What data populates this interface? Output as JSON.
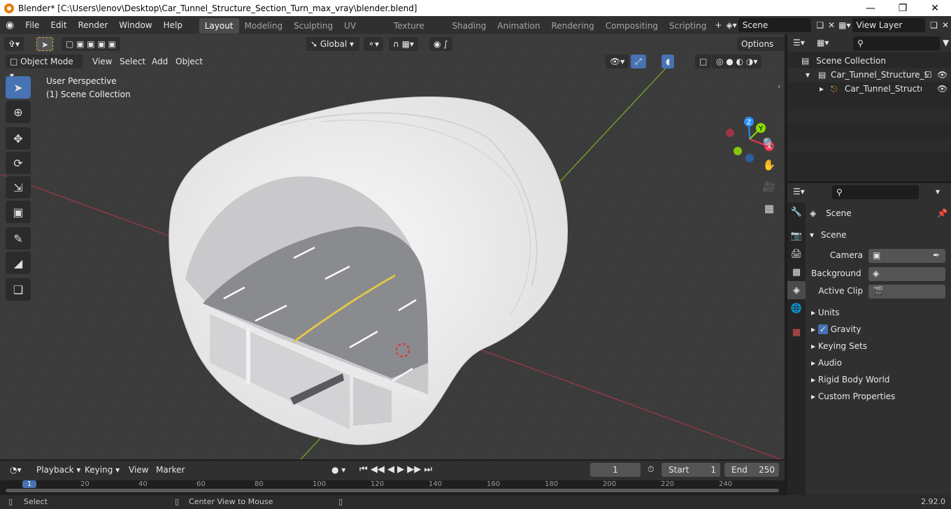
{
  "window": {
    "title": "Blender* [C:\\Users\\lenov\\Desktop\\Car_Tunnel_Structure_Section_Turn_max_vray\\blender.blend]"
  },
  "menu": [
    "File",
    "Edit",
    "Render",
    "Window",
    "Help"
  ],
  "workspaces": [
    "Layout",
    "Modeling",
    "Sculpting",
    "UV Editing",
    "Texture Paint",
    "Shading",
    "Animation",
    "Rendering",
    "Compositing",
    "Scripting"
  ],
  "scene": {
    "name": "Scene"
  },
  "viewlayer": {
    "name": "View Layer"
  },
  "viewport": {
    "mode": "Object Mode",
    "menus": [
      "View",
      "Select",
      "Add",
      "Object"
    ],
    "transform_orientation": "Global",
    "options_label": "Options",
    "perspective": "User Perspective",
    "collection": "(1) Scene Collection"
  },
  "gizmo": {
    "x": "X",
    "y": "Y",
    "z": "Z"
  },
  "outliner": {
    "root": "Scene Collection",
    "items": [
      "Car_Tunnel_Structure_Se",
      "Car_Tunnel_Structure"
    ]
  },
  "properties": {
    "context": "Scene",
    "panel": "Scene",
    "camera_label": "Camera",
    "background_label": "Background ...",
    "clip_label": "Active Clip",
    "sections": [
      "Units",
      "Gravity",
      "Keying Sets",
      "Audio",
      "Rigid Body World",
      "Custom Properties"
    ]
  },
  "timeline": {
    "menus": [
      "Playback",
      "Keying",
      "View",
      "Marker"
    ],
    "current_frame": "1",
    "start_label": "Start",
    "start": "1",
    "end_label": "End",
    "end": "250",
    "ticks": [
      "1",
      "20",
      "40",
      "60",
      "80",
      "100",
      "120",
      "140",
      "160",
      "180",
      "200",
      "220",
      "240"
    ]
  },
  "status": {
    "left": "Select",
    "middle": "Center View to Mouse",
    "version": "2.92.0"
  },
  "colors": {
    "accent": "#4772b3",
    "x_axis": "#ff3352",
    "y_axis": "#8bdc00",
    "z_axis": "#2890ff"
  }
}
